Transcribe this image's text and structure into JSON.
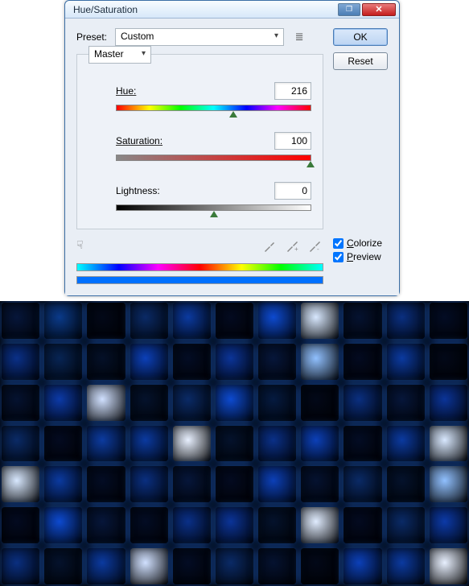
{
  "titlebar": {
    "title": "Hue/Saturation"
  },
  "buttons": {
    "ok": "OK",
    "reset": "Reset"
  },
  "preset": {
    "label": "Preset:",
    "value": "Custom"
  },
  "channel": {
    "value": "Master"
  },
  "sliders": {
    "hue": {
      "label": "Hue:",
      "value": "216",
      "pos_pct": 60
    },
    "sat": {
      "label": "Saturation:",
      "value": "100",
      "pos_pct": 100
    },
    "light": {
      "label": "Lightness:",
      "value": "0",
      "pos_pct": 50
    }
  },
  "checks": {
    "colorize": "Colorize",
    "preview": "Preview"
  },
  "grid_colors": [
    "#06163a",
    "#0a3a8a",
    "#020818",
    "#0a2a66",
    "#0b3aa0",
    "#030a20",
    "#0d4ad0",
    "#d8e8ff",
    "#051230",
    "#0a2f80",
    "#030c24",
    "#0a3088",
    "#072454",
    "#041028",
    "#0c40b8",
    "#030c24",
    "#0b3498",
    "#06163a",
    "#90c0ff",
    "#030a20",
    "#0b3aa0",
    "#020818",
    "#051230",
    "#0c3aa8",
    "#d0e0ff",
    "#04122c",
    "#0a2a66",
    "#0d4ad0",
    "#051a40",
    "#020818",
    "#0a2f80",
    "#06163a",
    "#0b3498",
    "#0a2a66",
    "#030a20",
    "#0c3ba0",
    "#0b3aa0",
    "#e8f0ff",
    "#04122c",
    "#0a3088",
    "#0c40b8",
    "#030c24",
    "#0b3aa0",
    "#d8e8ff",
    "#d8e8ff",
    "#0b3aa0",
    "#030c24",
    "#0a2f80",
    "#06163a",
    "#030a20",
    "#0c40b8",
    "#051230",
    "#0a2a66",
    "#04122c",
    "#90c0ff",
    "#030a20",
    "#0d4ad0",
    "#06163a",
    "#030c24",
    "#0a3088",
    "#0b3498",
    "#04122c",
    "#e0ecff",
    "#030a20",
    "#0a2a66",
    "#0c3aa8",
    "#0a2f80",
    "#04122c",
    "#0b3aa0",
    "#d0e0ff",
    "#030c24",
    "#0a2a66",
    "#051230",
    "#020818",
    "#0c40b8",
    "#0b3aa0",
    "#e8f0ff"
  ]
}
